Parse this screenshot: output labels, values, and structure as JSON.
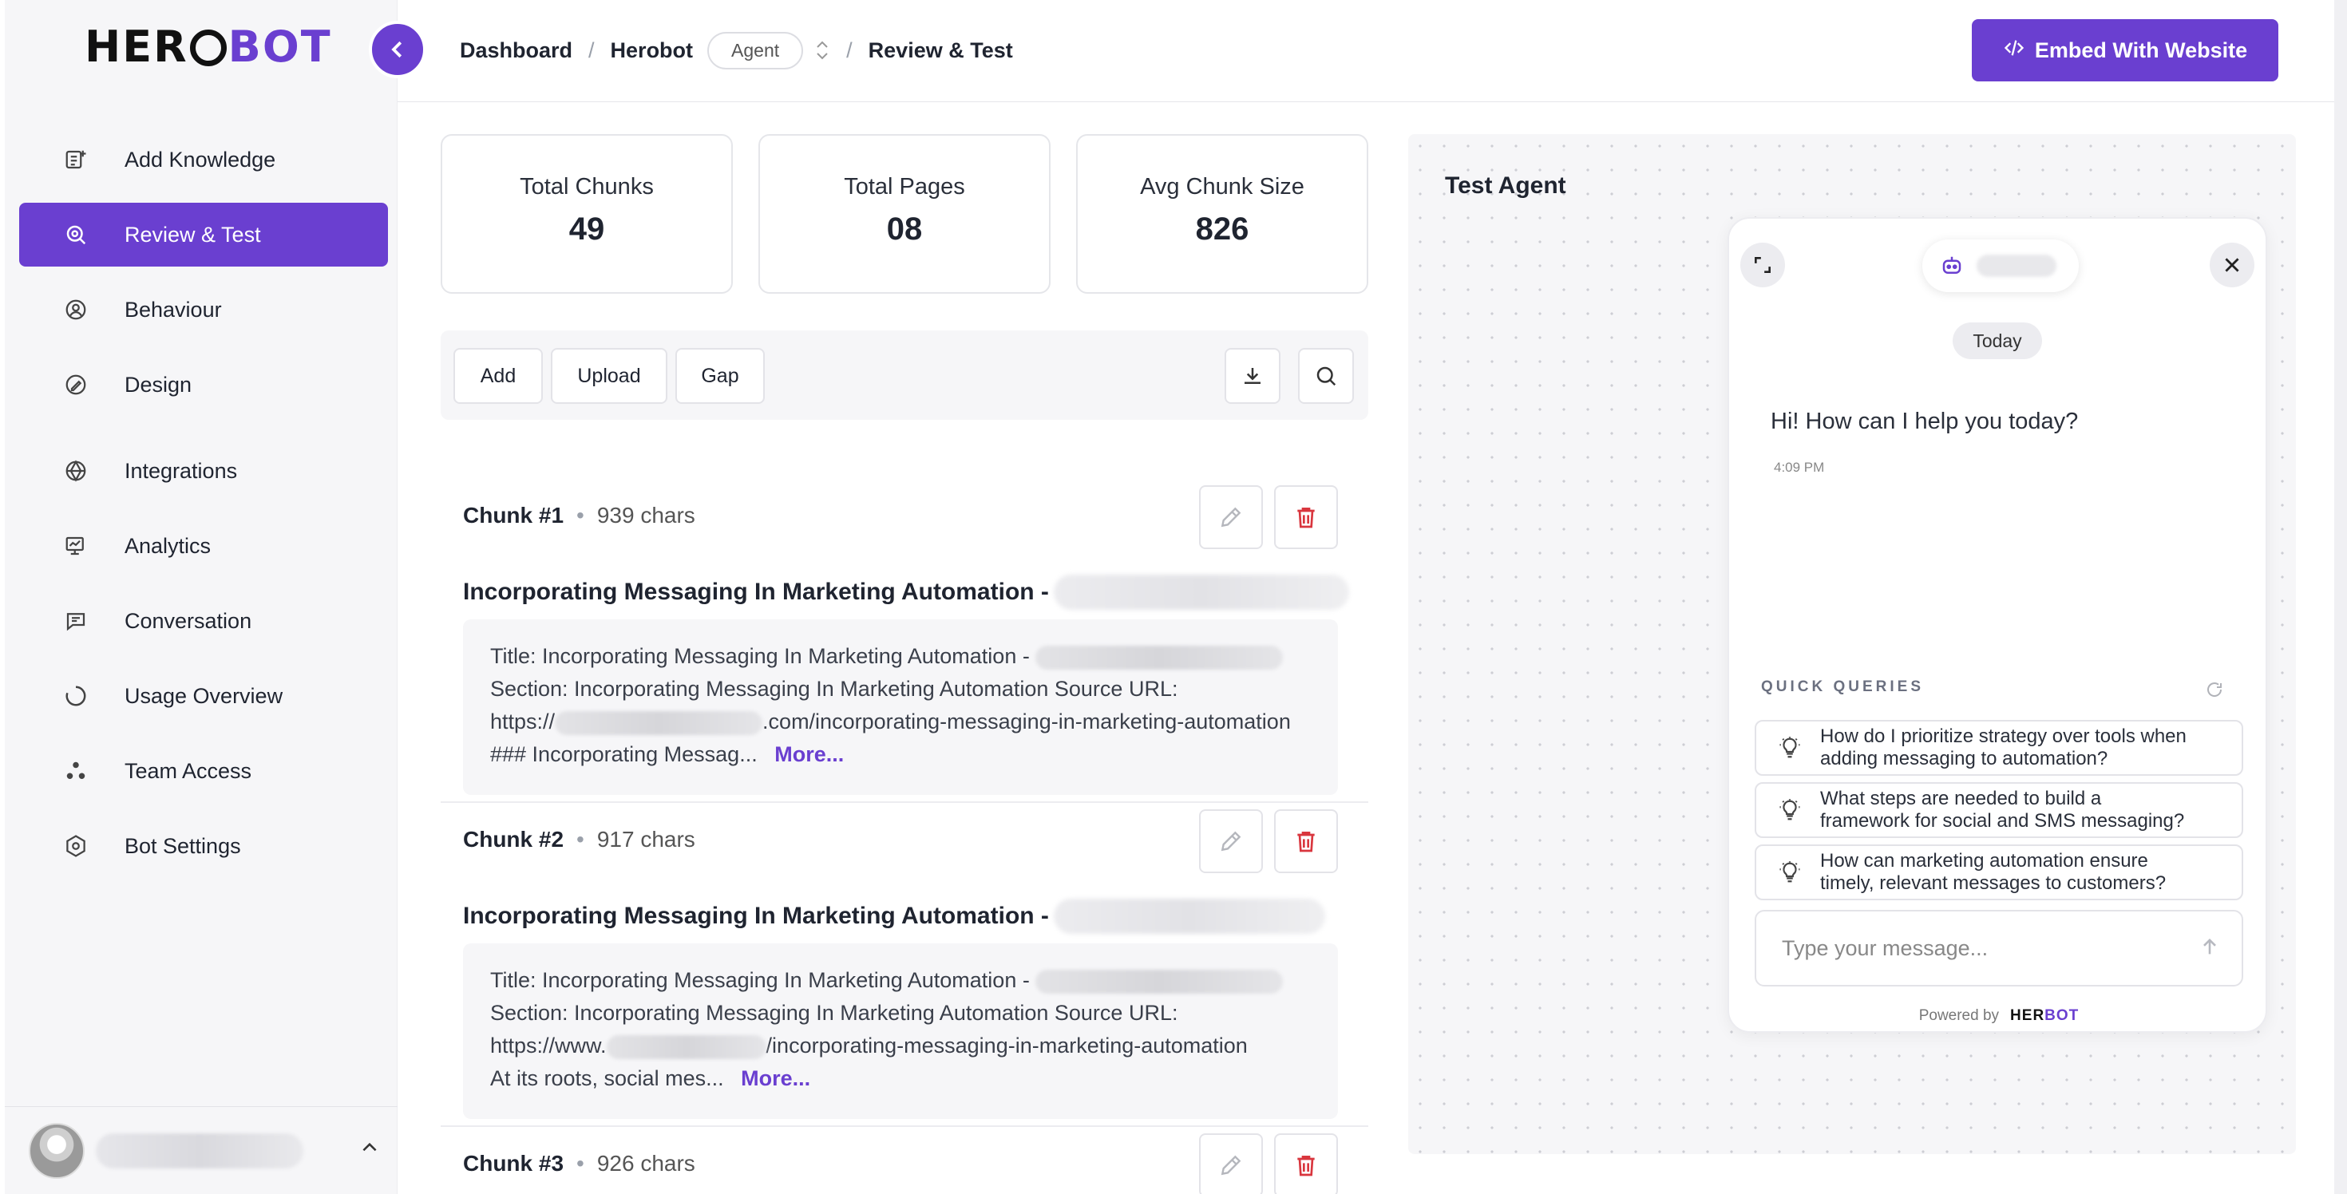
{
  "brand": {
    "logo_left": "HER",
    "logo_right": "BOT"
  },
  "sidebar": {
    "items": [
      {
        "label": "Add Knowledge",
        "icon": "add-knowledge-icon"
      },
      {
        "label": "Review & Test",
        "icon": "review-search-icon",
        "active": true
      },
      {
        "label": "Behaviour",
        "icon": "behaviour-icon"
      },
      {
        "label": "Design",
        "icon": "design-brush-icon"
      },
      {
        "label": "Integrations",
        "icon": "integrations-icon"
      },
      {
        "label": "Analytics",
        "icon": "analytics-icon"
      },
      {
        "label": "Conversation",
        "icon": "conversation-icon"
      },
      {
        "label": "Usage Overview",
        "icon": "usage-icon"
      },
      {
        "label": "Team Access",
        "icon": "team-icon"
      },
      {
        "label": "Bot Settings",
        "icon": "bot-settings-icon"
      }
    ]
  },
  "breadcrumb": {
    "dashboard": "Dashboard",
    "bot": "Herobot",
    "agent_pill": "Agent",
    "current": "Review & Test",
    "separator": "/"
  },
  "header": {
    "embed_label": "Embed With Website",
    "embed_icon": "code-icon"
  },
  "stats": [
    {
      "label": "Total Chunks",
      "value": "49"
    },
    {
      "label": "Total Pages",
      "value": "08"
    },
    {
      "label": "Avg Chunk Size",
      "value": "826"
    }
  ],
  "toolbar": {
    "add": "Add",
    "upload": "Upload",
    "gap": "Gap"
  },
  "chunks": [
    {
      "name": "Chunk #1",
      "chars": "939 chars",
      "title": "Incorporating Messaging In Marketing Automation -",
      "line1": "Title: Incorporating Messaging In Marketing Automation -",
      "line2": "Section: Incorporating Messaging In Marketing Automation Source URL:",
      "line3a": "https://",
      "line3b": ".com/incorporating-messaging-in-marketing-automation",
      "line4": "### Incorporating Messag...",
      "more": "More..."
    },
    {
      "name": "Chunk #2",
      "chars": "917 chars",
      "title": "Incorporating Messaging In Marketing Automation -",
      "line1": "Title: Incorporating Messaging In Marketing Automation -",
      "line2": "Section: Incorporating Messaging In Marketing Automation Source URL:",
      "line3a": "https://www.",
      "line3b": "/incorporating-messaging-in-marketing-automation",
      "line4": "At its roots, social mes...",
      "more": "More..."
    },
    {
      "name": "Chunk #3",
      "chars": "926 chars"
    }
  ],
  "chunk_separator": "•",
  "test_agent": {
    "title": "Test Agent",
    "today": "Today",
    "greeting": "Hi! How can I help you today?",
    "greeting_time": "4:09 PM",
    "quick_queries_label": "QUICK QUERIES",
    "queries": [
      {
        "line1": "How do I prioritize strategy over tools when",
        "line2": "adding messaging to automation?"
      },
      {
        "line1": "What steps are needed to build a",
        "line2": "framework for social and SMS messaging?"
      },
      {
        "line1": "How can marketing automation ensure",
        "line2": "timely, relevant messages to customers?"
      }
    ],
    "input_placeholder": "Type your message...",
    "powered_by": "Powered by",
    "powered_logo_left": "HER",
    "powered_logo_right": "BOT"
  },
  "colors": {
    "accent": "#6a3fd0",
    "delete": "#d9363e"
  }
}
